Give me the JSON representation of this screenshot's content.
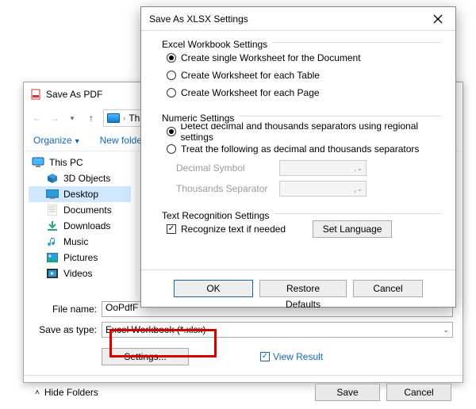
{
  "back": {
    "title": "Save As PDF",
    "path_crumb": "This",
    "toolbar": {
      "organize": "Organize",
      "new_folder": "New folder"
    },
    "tree": {
      "root": "This PC",
      "items": [
        "3D Objects",
        "Desktop",
        "Documents",
        "Downloads",
        "Music",
        "Pictures",
        "Videos"
      ],
      "selected_index": 1
    },
    "fields": {
      "file_name_label": "File name:",
      "file_name_value": "OoPdfF",
      "save_as_type_label": "Save as type:",
      "save_as_type_value": "Excel Workbook (*.xlsx)"
    },
    "settings_button": "Settings...",
    "view_result_label": "View Result",
    "view_result_checked": true,
    "hide_folders": "Hide Folders",
    "save_button": "Save",
    "cancel_button": "Cancel"
  },
  "front": {
    "title": "Save As XLSX Settings",
    "groups": {
      "workbook": {
        "title": "Excel Workbook Settings",
        "options": [
          "Create single Worksheet for the Document",
          "Create Worksheet for each Table",
          "Create Worksheet for each Page"
        ],
        "selected": 0
      },
      "numeric": {
        "title": "Numeric Settings",
        "options": [
          "Detect decimal and thousands separators using regional settings",
          "Treat the following as decimal and thousands separators"
        ],
        "selected": 0,
        "decimal_label": "Decimal Symbol",
        "decimal_value": ".",
        "thousands_label": "Thousands Separator",
        "thousands_value": ","
      },
      "text": {
        "title": "Text Recognition Settings",
        "recognize_label": "Recognize text if needed",
        "recognize_checked": true,
        "set_language": "Set Language"
      }
    },
    "buttons": {
      "ok": "OK",
      "restore": "Restore Defaults",
      "cancel": "Cancel"
    }
  }
}
